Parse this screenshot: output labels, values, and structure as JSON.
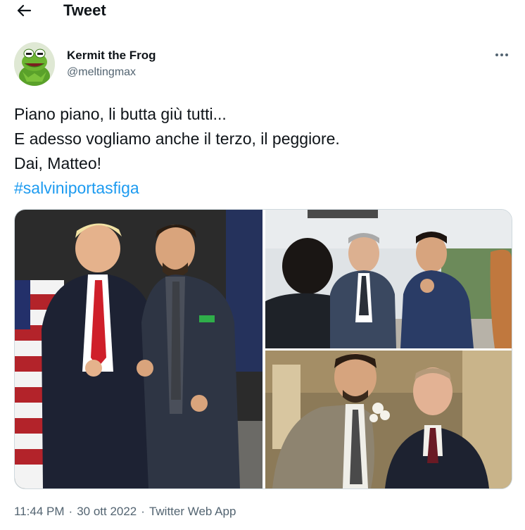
{
  "header": {
    "back_icon": "arrow-left-icon",
    "title": "Tweet"
  },
  "author": {
    "display_name": "Kermit the Frog",
    "handle": "@meltingmax",
    "avatar_icon": "kermit-avatar",
    "more_icon": "ellipsis-icon"
  },
  "tweet": {
    "lines": [
      "Piano piano, li butta giù tutti...",
      "E adesso vogliamo anche il terzo, il peggiore.",
      "Dai, Matteo!"
    ],
    "hashtag": "#salviniportasfiga"
  },
  "media": {
    "photo_count": 3
  },
  "meta": {
    "time": "11:44 PM",
    "separator": "·",
    "date": "30 ott 2022",
    "source": "Twitter Web App"
  },
  "colors": {
    "link": "#1d9bf0",
    "secondary_text": "#536471",
    "primary_text": "#0f1419"
  }
}
